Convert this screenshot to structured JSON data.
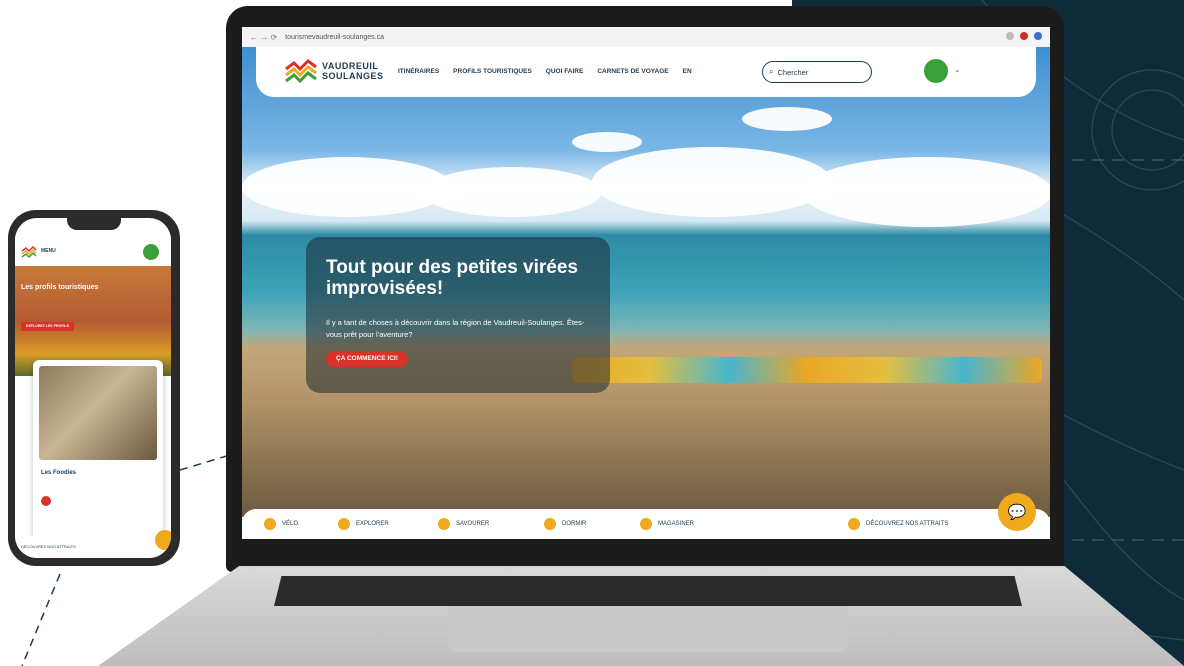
{
  "browser": {
    "url": "tourismevaudreuil-soulanges.ca"
  },
  "site": {
    "logo_line1": "VAUDREUIL",
    "logo_line2": "SOULANGES",
    "menu": [
      "ITINÉRAIRES",
      "PROFILS TOURISTIQUES",
      "QUOI FAIRE",
      "CARNETS DE VOYAGE",
      "EN"
    ],
    "search_placeholder": "Chercher"
  },
  "hero": {
    "title": "Tout pour des petites virées improvisées!",
    "subtitle": "Il y a tant de choses à découvrir dans la région de Vaudreuil-Soulanges. Êtes-vous prêt pour l'aventure?",
    "button": "ÇA COMMENCE ICI!"
  },
  "categories": [
    "VÉLO",
    "EXPLORER",
    "SAVOURER",
    "DORMIR",
    "MAGASINER"
  ],
  "discover_all": "DÉCOUVREZ NOS ATTRAITS",
  "phone": {
    "menu_label": "MENU",
    "hero_title": "Les profils touristiques",
    "hero_button": "EXPLOREZ LES PROFILS",
    "card_title": "Les Foodies",
    "footer_label": "DÉCOUVREZ NOS ATTRAITS"
  },
  "colors": {
    "navy": "#0e2b3a",
    "accent_red": "#d8322a",
    "accent_orange": "#f0a81d",
    "brand_green": "#3b9f3a"
  }
}
